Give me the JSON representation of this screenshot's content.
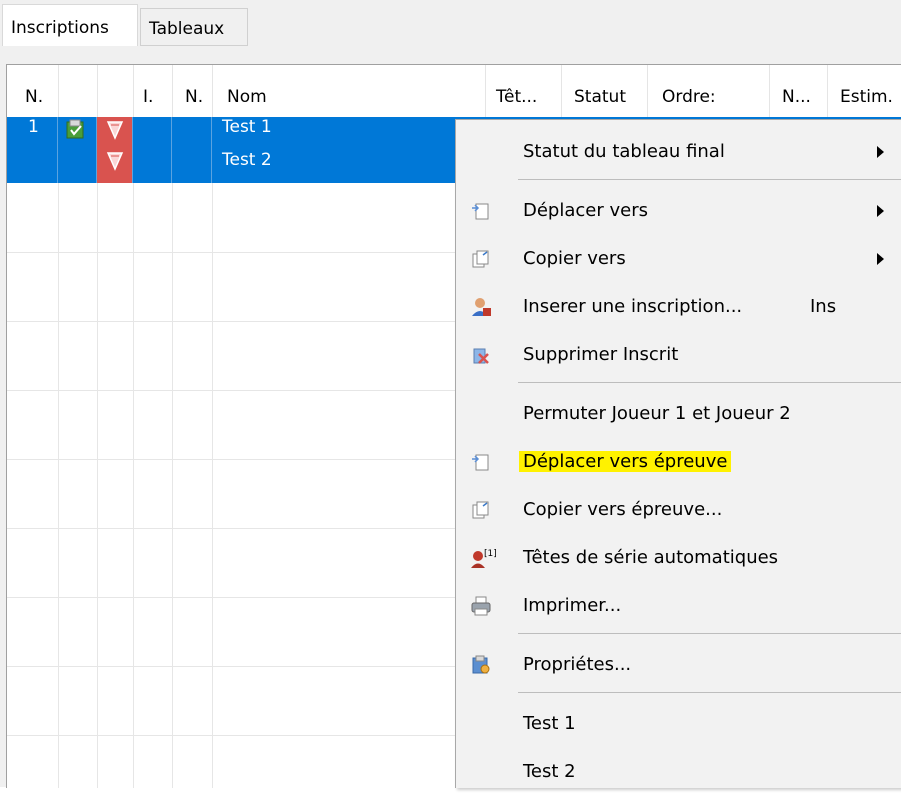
{
  "tabs": [
    {
      "label": "Inscriptions"
    },
    {
      "label": "Tableaux"
    }
  ],
  "columns": [
    "N.",
    "",
    "",
    "I.",
    "N.",
    "Nom",
    "Têt...",
    "Statut",
    "Ordre:",
    "N...",
    "Estim."
  ],
  "row": {
    "num": "1",
    "names": [
      "Test 1",
      "Test 2"
    ]
  },
  "menu": {
    "items": [
      {
        "label": "Statut du tableau final",
        "icon": "",
        "submenu": true
      },
      {
        "label": "Déplacer vers",
        "icon": "move-icon",
        "submenu": true
      },
      {
        "label": "Copier vers",
        "icon": "copy-icon",
        "submenu": true
      },
      {
        "label": "Inserer une inscription...",
        "icon": "insert-user-icon",
        "shortcut": "Ins"
      },
      {
        "label": "Supprimer Inscrit",
        "icon": "delete-user-icon"
      },
      {
        "label": "Permuter Joueur 1 et Joueur 2",
        "icon": ""
      },
      {
        "label": "Déplacer vers épreuve",
        "icon": "move-icon",
        "highlighted": true,
        "highlight_color": "#fff200"
      },
      {
        "label": "Copier vers épreuve...",
        "icon": "copy-icon"
      },
      {
        "label": "Têtes de série automatiques",
        "icon": "seed-icon",
        "icon_text": "[1]"
      },
      {
        "label": "Imprimer...",
        "icon": "printer-icon"
      },
      {
        "label": "Propriétes...",
        "icon": "properties-icon"
      },
      {
        "label": "Test 1",
        "icon": ""
      },
      {
        "label": "Test 2",
        "icon": ""
      }
    ]
  },
  "colors": {
    "selection": "#0078d7",
    "highlight": "#fff200",
    "menu_bg": "#f2f2f2"
  }
}
